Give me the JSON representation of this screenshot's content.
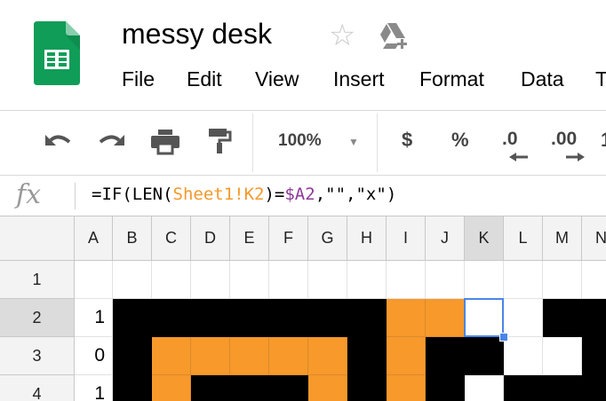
{
  "app": {
    "doc_title": "messy desk",
    "star_icon": "star-icon",
    "drive_icon": "add-to-drive-icon",
    "brand_color": "#0f9d58"
  },
  "menu": [
    "File",
    "Edit",
    "View",
    "Insert",
    "Format",
    "Data",
    "T"
  ],
  "toolbar": {
    "undo_icon": "undo-icon",
    "redo_icon": "redo-icon",
    "print_icon": "print-icon",
    "paint_format_icon": "paint-format-icon",
    "zoom": "100%",
    "currency": "$",
    "percent": "%",
    "decrease_decimal": ".0",
    "increase_decimal": ".00"
  },
  "formula_bar": {
    "fx": "fx",
    "tokens": [
      {
        "text": "=IF(LEN(",
        "kind": "plain"
      },
      {
        "text": "Sheet1!K2",
        "kind": "ref"
      },
      {
        "text": ")=",
        "kind": "plain"
      },
      {
        "text": "$A2",
        "kind": "abs"
      },
      {
        "text": ",",
        "kind": "plain"
      },
      {
        "text": "\"\"",
        "kind": "plain"
      },
      {
        "text": ",",
        "kind": "plain"
      },
      {
        "text": "\"x\"",
        "kind": "plain"
      },
      {
        "text": ")",
        "kind": "plain"
      }
    ]
  },
  "grid": {
    "columns": [
      "A",
      "B",
      "C",
      "D",
      "E",
      "F",
      "G",
      "H",
      "I",
      "J",
      "K",
      "L",
      "M",
      "N"
    ],
    "selected_column": "K",
    "rows": [
      {
        "label": "1",
        "selected": false,
        "a_value": "",
        "cells": "wwwwwwwwwwwww"
      },
      {
        "label": "2",
        "selected": true,
        "a_value": "1",
        "cells": "kkkkkkkoowwkk"
      },
      {
        "label": "3",
        "selected": false,
        "a_value": "0",
        "cells": "koooookokkwwk"
      },
      {
        "label": "4",
        "selected": false,
        "a_value": "1",
        "cells": "kokkkokokwkkk"
      }
    ],
    "active_cell": "K2",
    "colors": {
      "orange": "#f7992b",
      "black": "#000000",
      "selection": "#4a86e8"
    }
  }
}
